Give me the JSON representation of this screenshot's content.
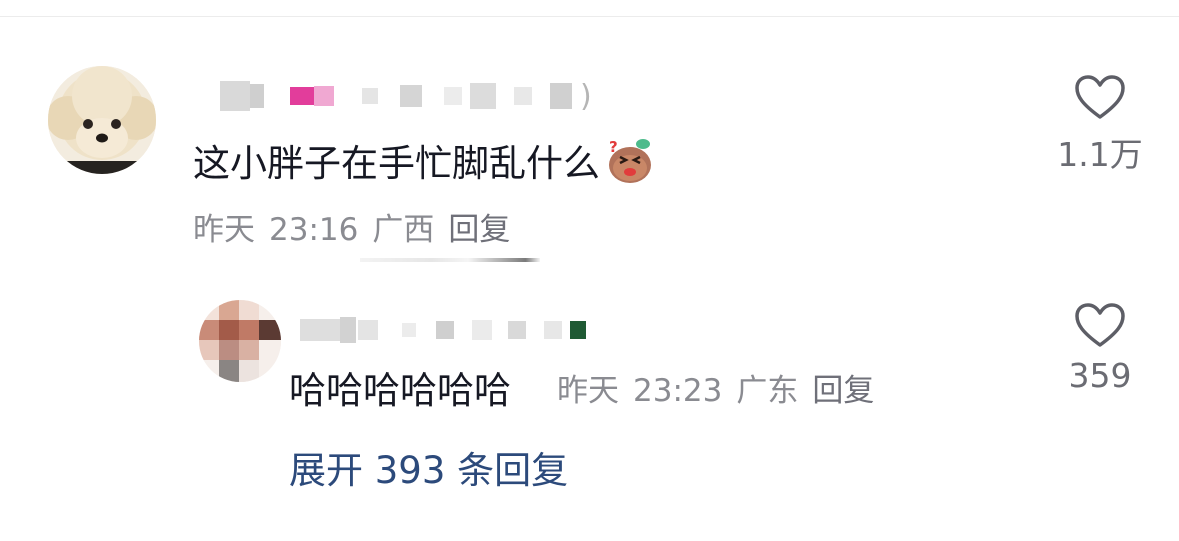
{
  "comments": [
    {
      "text": "这小胖子在手忙脚乱什么",
      "emoji": "sweating-blob-emoji",
      "time": "昨天",
      "clock": "23:16",
      "location": "广西",
      "reply_label": "回复",
      "likes": "1.1万",
      "username_suffix": ")"
    }
  ],
  "replies": [
    {
      "text": "哈哈哈哈哈哈",
      "time": "昨天",
      "clock": "23:23",
      "location": "广东",
      "reply_label": "回复",
      "likes": "359"
    }
  ],
  "expand_label": "展开 393 条回复",
  "icons": {
    "like": "heart-outline-icon"
  },
  "colors": {
    "text": "#161823",
    "meta": "#8a8b91",
    "link": "#2c4a7b"
  }
}
